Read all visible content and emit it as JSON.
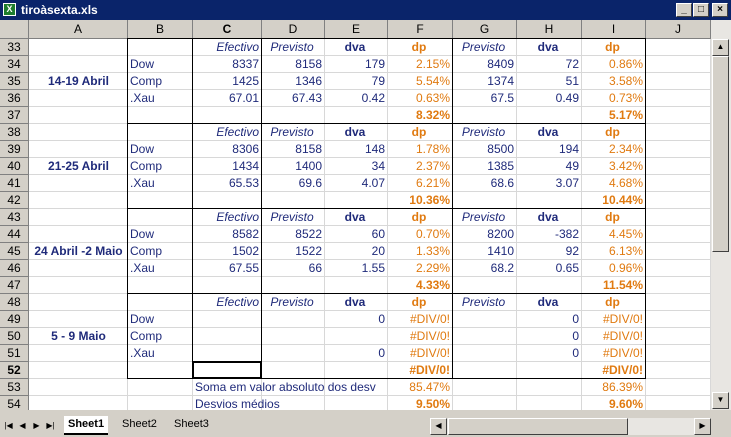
{
  "window": {
    "title": "tiroàsexta.xls",
    "minimize": "_",
    "maximize": "□",
    "close": "×"
  },
  "columns": [
    "A",
    "B",
    "C",
    "D",
    "E",
    "F",
    "G",
    "H",
    "I",
    "J"
  ],
  "selected_column": "C",
  "rows": [
    "33",
    "34",
    "35",
    "36",
    "37",
    "38",
    "39",
    "40",
    "41",
    "42",
    "43",
    "44",
    "45",
    "46",
    "47",
    "48",
    "49",
    "50",
    "51",
    "52",
    "53",
    "54"
  ],
  "selected_row": "52",
  "headers": {
    "efectivo": "Efectivo",
    "previsto": "Previsto",
    "dva": "dva",
    "dp": "dp"
  },
  "items": [
    "Dow",
    "Comp",
    ".Xau"
  ],
  "blocks": [
    {
      "label": "14-19 Abril",
      "rows": [
        [
          "8337",
          "8158",
          "179",
          "2.15%",
          "8409",
          "72",
          "0.86%"
        ],
        [
          "1425",
          "1346",
          "79",
          "5.54%",
          "1374",
          "51",
          "3.58%"
        ],
        [
          "67.01",
          "67.43",
          "0.42",
          "0.63%",
          "67.5",
          "0.49",
          "0.73%"
        ]
      ],
      "total_f": "8.32%",
      "total_i": "5.17%"
    },
    {
      "label": "21-25 Abril",
      "rows": [
        [
          "8306",
          "8158",
          "148",
          "1.78%",
          "8500",
          "194",
          "2.34%"
        ],
        [
          "1434",
          "1400",
          "34",
          "2.37%",
          "1385",
          "49",
          "3.42%"
        ],
        [
          "65.53",
          "69.6",
          "4.07",
          "6.21%",
          "68.6",
          "3.07",
          "4.68%"
        ]
      ],
      "total_f": "10.36%",
      "total_i": "10.44%"
    },
    {
      "label": "24 Abril -2 Maio",
      "rows": [
        [
          "8582",
          "8522",
          "60",
          "0.70%",
          "8200",
          "-382",
          "4.45%"
        ],
        [
          "1502",
          "1522",
          "20",
          "1.33%",
          "1410",
          "92",
          "6.13%"
        ],
        [
          "67.55",
          "66",
          "1.55",
          "2.29%",
          "68.2",
          "0.65",
          "0.96%"
        ]
      ],
      "total_f": "4.33%",
      "total_i": "11.54%"
    },
    {
      "label": "5 - 9 Maio",
      "rows": [
        [
          "",
          "",
          "0",
          "#DIV/0!",
          "",
          "0",
          "#DIV/0!"
        ],
        [
          "",
          "",
          "",
          "#DIV/0!",
          "",
          "0",
          "#DIV/0!"
        ],
        [
          "",
          "",
          "0",
          "#DIV/0!",
          "",
          "0",
          "#DIV/0!"
        ]
      ],
      "total_f": "#DIV/0!",
      "total_i": "#DIV/0!"
    }
  ],
  "summary": {
    "soma_label": "Soma em valor absoluto dos desv",
    "soma_f": "85.47%",
    "soma_i": "86.39%",
    "desvios_label": "Desvios médios",
    "desvios_f": "9.50%",
    "desvios_i": "9.60%"
  },
  "sheets": [
    {
      "name": "Sheet1",
      "active": true
    },
    {
      "name": "Sheet2",
      "active": false
    },
    {
      "name": "Sheet3",
      "active": false
    }
  ],
  "nav": {
    "first": "|◀",
    "prev": "◀",
    "next": "▶",
    "last": "▶|"
  }
}
